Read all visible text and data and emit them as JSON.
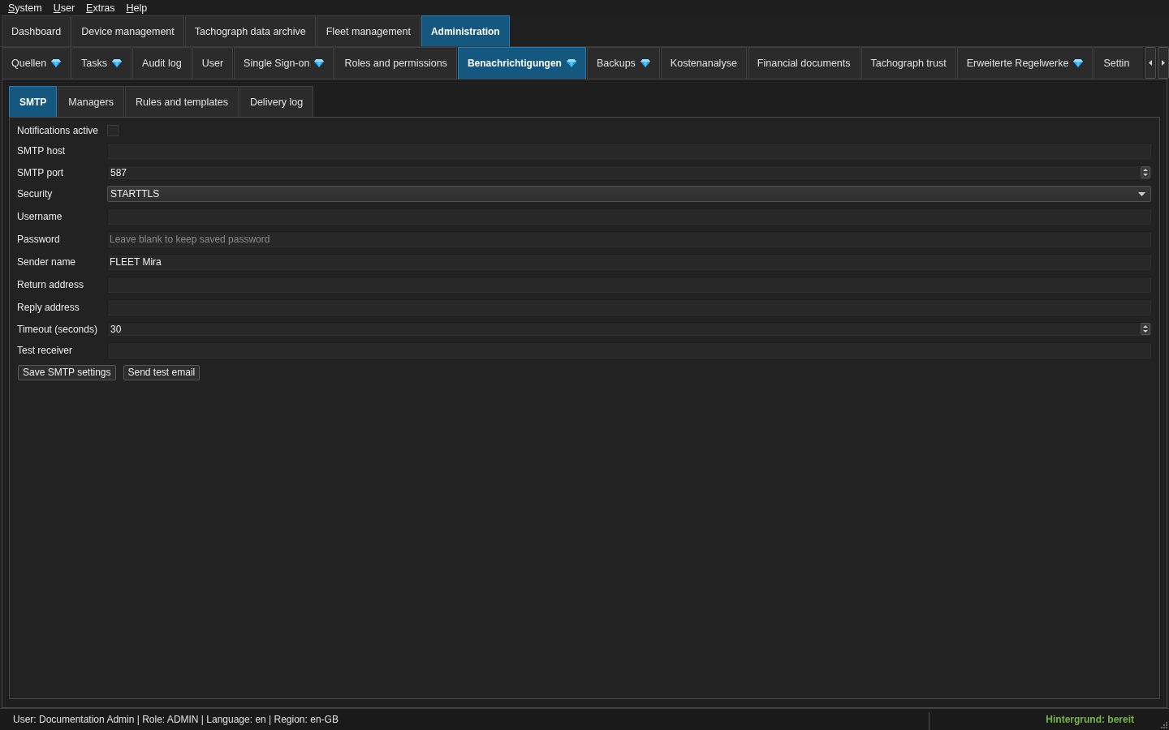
{
  "menu_bar": [
    "System",
    "User",
    "Extras",
    "Help"
  ],
  "main_tabs": [
    {
      "label": "Dashboard",
      "selected": false
    },
    {
      "label": "Device management",
      "selected": false
    },
    {
      "label": "Tachograph data archive",
      "selected": false
    },
    {
      "label": "Fleet management",
      "selected": false
    },
    {
      "label": "Administration",
      "selected": true
    }
  ],
  "sub_tabs": [
    {
      "label": "Quellen",
      "gem": true,
      "selected": false
    },
    {
      "label": "Tasks",
      "gem": true,
      "selected": false
    },
    {
      "label": "Audit log",
      "gem": false,
      "selected": false
    },
    {
      "label": "User",
      "gem": false,
      "selected": false
    },
    {
      "label": "Single Sign-on",
      "gem": true,
      "selected": false
    },
    {
      "label": "Roles and permissions",
      "gem": false,
      "selected": false
    },
    {
      "label": "Benachrichtigungen",
      "gem": true,
      "selected": true
    },
    {
      "label": "Backups",
      "gem": true,
      "selected": false
    },
    {
      "label": "Kostenanalyse",
      "gem": false,
      "selected": false
    },
    {
      "label": "Financial documents",
      "gem": false,
      "selected": false
    },
    {
      "label": "Tachograph trust",
      "gem": false,
      "selected": false
    },
    {
      "label": "Erweiterte Regelwerke",
      "gem": true,
      "selected": false
    },
    {
      "label": "Settin",
      "gem": false,
      "selected": false
    }
  ],
  "section_tabs": [
    {
      "label": "SMTP",
      "selected": true
    },
    {
      "label": "Managers",
      "selected": false
    },
    {
      "label": "Rules and templates",
      "selected": false
    },
    {
      "label": "Delivery log",
      "selected": false
    }
  ],
  "smtp_form": {
    "fields": [
      {
        "label": "Notifications active",
        "kind": "checkbox",
        "checked": false
      },
      {
        "label": "SMTP host",
        "kind": "text"
      },
      {
        "label": "SMTP port",
        "kind": "number",
        "value": "587"
      },
      {
        "label": "Security",
        "kind": "select",
        "value": "STARTTLS"
      },
      {
        "label": "Username",
        "kind": "text"
      },
      {
        "label": "Password",
        "kind": "password",
        "placeholder": "Leave blank to keep saved password"
      },
      {
        "label": "Sender name",
        "kind": "text",
        "value": "FLEET Mira"
      },
      {
        "label": "Return address",
        "kind": "text"
      },
      {
        "label": "Reply address",
        "kind": "text"
      },
      {
        "label": "Timeout (seconds)",
        "kind": "number",
        "value": "30"
      },
      {
        "label": "Test receiver",
        "kind": "text"
      }
    ],
    "buttons": [
      "Save SMTP settings",
      "Send test email"
    ]
  },
  "status_bar": {
    "session_info": "User: Documentation Admin | Role: ADMIN | Language: en | Region: en-GB",
    "background_status": "Hintergrund: bereit"
  }
}
